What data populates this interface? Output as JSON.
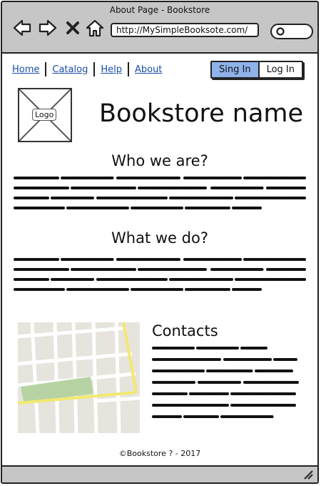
{
  "window": {
    "title": "About Page - Bookstore"
  },
  "toolbar": {
    "url": "http://MySimpleBooksote.com/"
  },
  "nav": {
    "links": [
      "Home",
      "Catalog",
      "Help",
      "About"
    ],
    "sign_in": "Sing In",
    "log_in": "Log In"
  },
  "header": {
    "logo_label": "Logo",
    "store_name": "Bookstore name"
  },
  "sections": {
    "who": {
      "title": "Who we are?"
    },
    "what": {
      "title": "What we do?"
    },
    "contacts": {
      "title": "Contacts"
    }
  },
  "footer": {
    "text": "©Bookstore ? - 2017"
  },
  "colors": {
    "chrome": "#c6c6c6",
    "accent": "#8fb2ea",
    "link": "#1b4ea8",
    "map_road": "#f2e970",
    "map_park": "#b7d3a3",
    "map_bg": "#e6e4dd"
  }
}
